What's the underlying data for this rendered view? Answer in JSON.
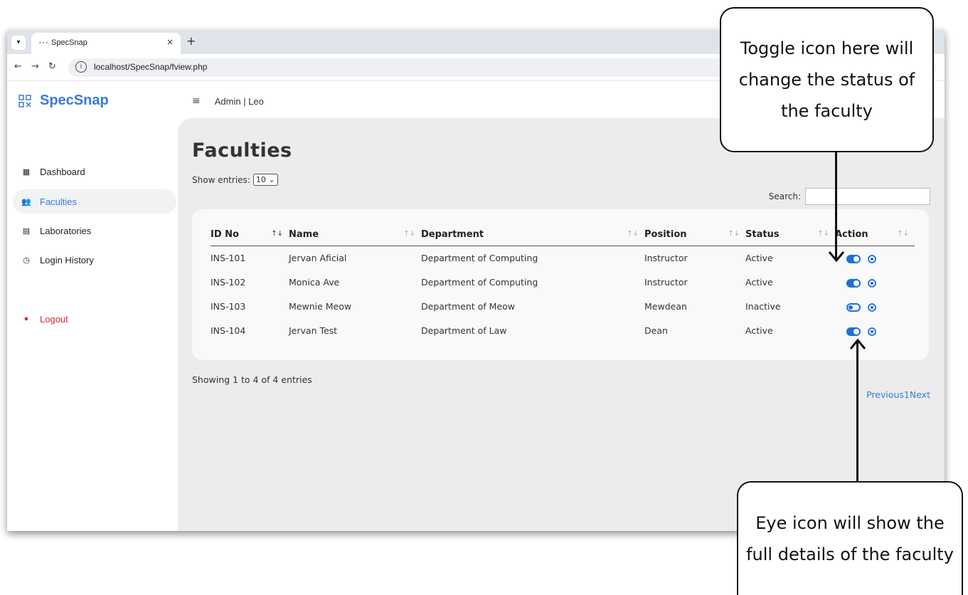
{
  "browser": {
    "tab_title": "SpecSnap",
    "tab_close": "×",
    "new_tab": "+",
    "url": "localhost/SpecSnap/fview.php"
  },
  "app": {
    "brand": "SpecSnap",
    "topbar_user": "Admin | Leo"
  },
  "sidebar": {
    "items": [
      {
        "label": "Dashboard",
        "icon": "dashboard-icon"
      },
      {
        "label": "Faculties",
        "icon": "users-icon"
      },
      {
        "label": "Laboratories",
        "icon": "building-icon"
      },
      {
        "label": "Login History",
        "icon": "clock-icon"
      },
      {
        "label": "Logout",
        "icon": "logout-icon"
      }
    ]
  },
  "page": {
    "title": "Faculties",
    "show_entries_label": "Show entries:",
    "entries_value": "10",
    "search_label": "Search:"
  },
  "table": {
    "headers": [
      "ID No",
      "Name",
      "Department",
      "Position",
      "Status",
      "Action"
    ],
    "rows": [
      {
        "id": "INS-101",
        "name": "Jervan Aficial",
        "department": "Department of Computing",
        "position": "Instructor",
        "status": "Active",
        "toggle": "on"
      },
      {
        "id": "INS-102",
        "name": "Monica Ave",
        "department": "Department of Computing",
        "position": "Instructor",
        "status": "Active",
        "toggle": "on"
      },
      {
        "id": "INS-103",
        "name": "Mewnie Meow",
        "department": "Department of Meow",
        "position": "Mewdean",
        "status": "Inactive",
        "toggle": "off"
      },
      {
        "id": "INS-104",
        "name": "Jervan Test",
        "department": "Department of Law",
        "position": "Dean",
        "status": "Active",
        "toggle": "on"
      }
    ]
  },
  "footer": {
    "showing": "Showing 1 to 4 of 4 entries",
    "pager": "Previous1Next"
  },
  "annotations": {
    "toggle_note": "Toggle icon here will change the status of the faculty",
    "eye_note": "Eye icon will show the full details of the faculty"
  },
  "colors": {
    "accent": "#3a7bd5",
    "toggle": "#1f6fd6",
    "logout": "#d32f2f"
  }
}
